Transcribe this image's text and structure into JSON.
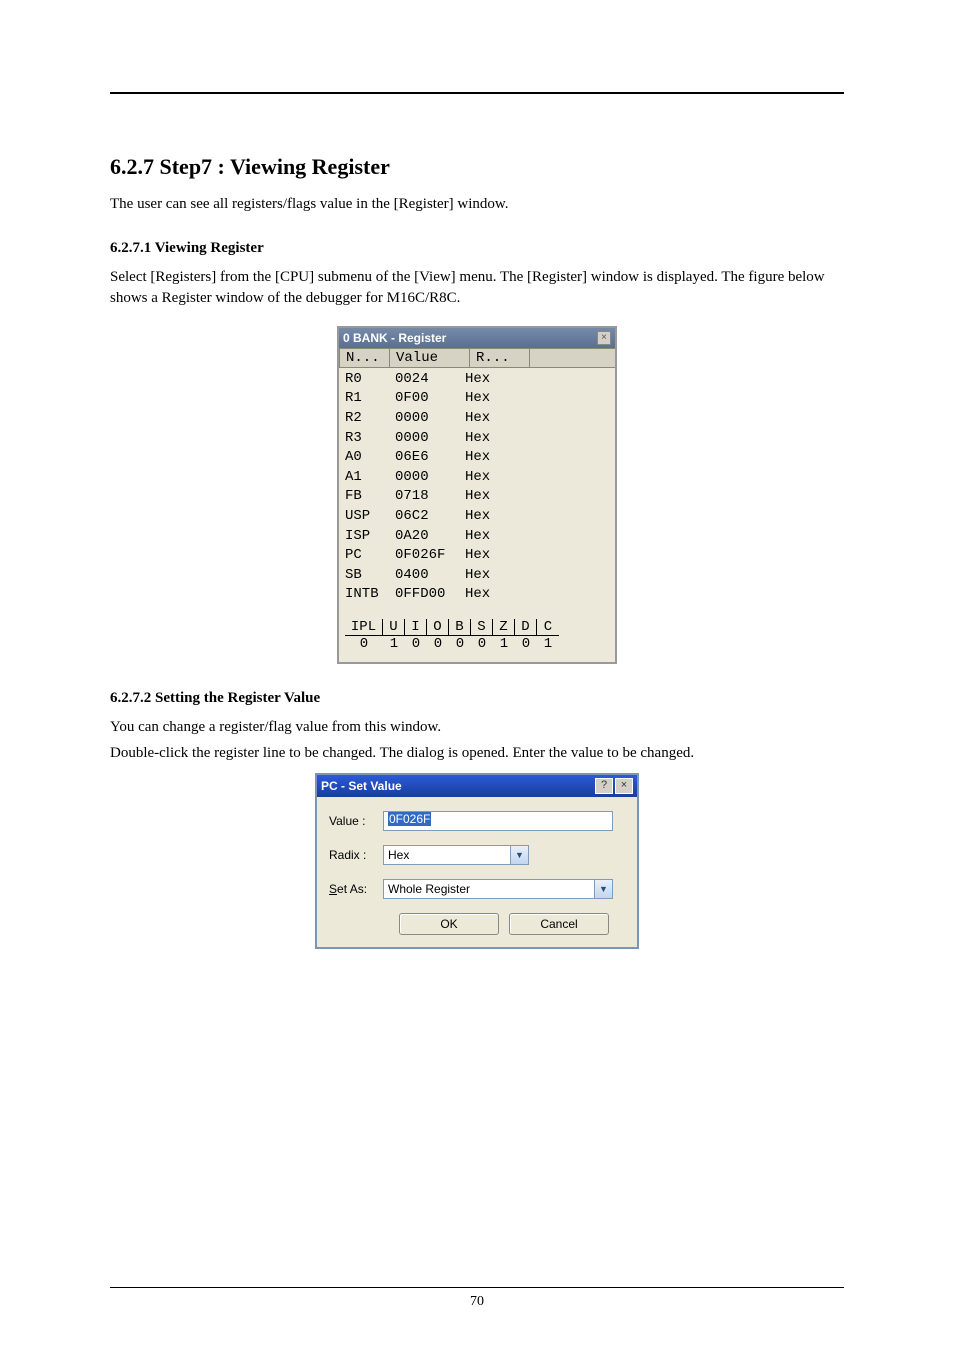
{
  "heading": "6.2.7 Step7 : Viewing Register",
  "intro": "The user can see all registers/flags value in the [Register] window.",
  "sub1_heading": "6.2.7.1 Viewing Register",
  "sub1_p1": "Select [Registers] from the [CPU] submenu of the [View] menu. The [Register] window is displayed. The figure below shows a Register window of the debugger for M16C/R8C.",
  "register_window": {
    "title": "0 BANK - Register",
    "columns": {
      "name": "N...",
      "value": "Value",
      "radix": "R..."
    },
    "rows": [
      {
        "name": "R0",
        "value": "0024",
        "radix": "Hex"
      },
      {
        "name": "R1",
        "value": "0F00",
        "radix": "Hex"
      },
      {
        "name": "R2",
        "value": "0000",
        "radix": "Hex"
      },
      {
        "name": "R3",
        "value": "0000",
        "radix": "Hex"
      },
      {
        "name": "A0",
        "value": "06E6",
        "radix": "Hex"
      },
      {
        "name": "A1",
        "value": "0000",
        "radix": "Hex"
      },
      {
        "name": "FB",
        "value": "0718",
        "radix": "Hex"
      },
      {
        "name": "USP",
        "value": "06C2",
        "radix": "Hex"
      },
      {
        "name": "ISP",
        "value": "0A20",
        "radix": "Hex"
      },
      {
        "name": "PC",
        "value": "0F026F",
        "radix": "Hex"
      },
      {
        "name": "SB",
        "value": "0400",
        "radix": "Hex"
      },
      {
        "name": "INTB",
        "value": "0FFD00",
        "radix": "Hex"
      }
    ],
    "flags": {
      "labels": [
        "IPL",
        "U",
        "I",
        "O",
        "B",
        "S",
        "Z",
        "D",
        "C"
      ],
      "values": [
        "0",
        "1",
        "0",
        "0",
        "0",
        "0",
        "1",
        "0",
        "1"
      ]
    }
  },
  "sub2_heading": "6.2.7.2 Setting the Register Value",
  "sub2_p1": "You can change a register/flag value from this window.",
  "sub2_p2": "Double-click the register line to be changed. The dialog is opened. Enter the value to be changed.",
  "set_value_dialog": {
    "title": "PC - Set Value",
    "labels": {
      "value": "Value :",
      "radix": "Radix :",
      "setas_prefix": "S",
      "setas_rest": "et As:"
    },
    "fields": {
      "value": "0F026F",
      "radix": "Hex",
      "setas": "Whole Register"
    },
    "buttons": {
      "ok": "OK",
      "cancel": "Cancel"
    }
  },
  "page_number": "70"
}
